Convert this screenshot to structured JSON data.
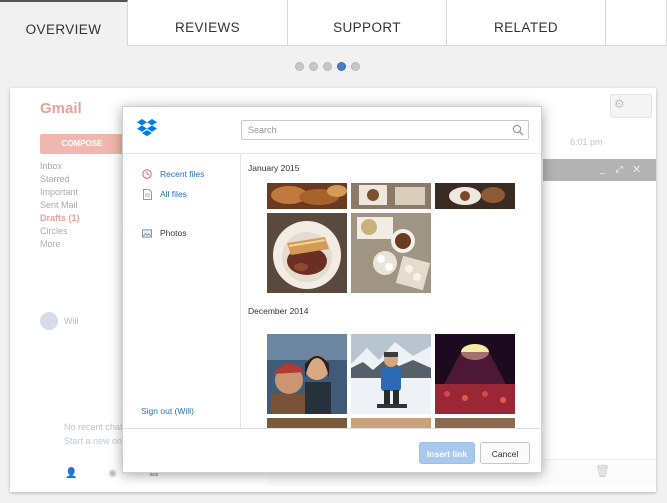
{
  "tabs": {
    "items": [
      {
        "label": "OVERVIEW"
      },
      {
        "label": "REVIEWS"
      },
      {
        "label": "SUPPORT"
      },
      {
        "label": "RELATED"
      }
    ],
    "active": "OVERVIEW"
  },
  "carousel": {
    "count": 5,
    "active_index": 3,
    "active_color": "#4a7ec2"
  },
  "gmail": {
    "logo": "Gmail",
    "compose_label": "COMPOSE",
    "nav": [
      "Inbox",
      "Starred",
      "Important",
      "Sent Mail",
      "Drafts (1)",
      "Circles",
      "More"
    ],
    "user": "Will",
    "time": "6:01 pm",
    "recent_note": "No recent chats",
    "recent_link": "Start a new one"
  },
  "dropbox": {
    "brand_color": "#007ee5",
    "search": {
      "placeholder": "Search",
      "value": ""
    },
    "sidebar": {
      "recent_files": "Recent files",
      "all_files": "All files",
      "photos": "Photos",
      "sign_out": "Sign out (Will)"
    },
    "sections": {
      "jan": "January 2015",
      "dec": "December 2014"
    },
    "buttons": {
      "insert_link": "Insert link",
      "cancel": "Cancel"
    }
  }
}
